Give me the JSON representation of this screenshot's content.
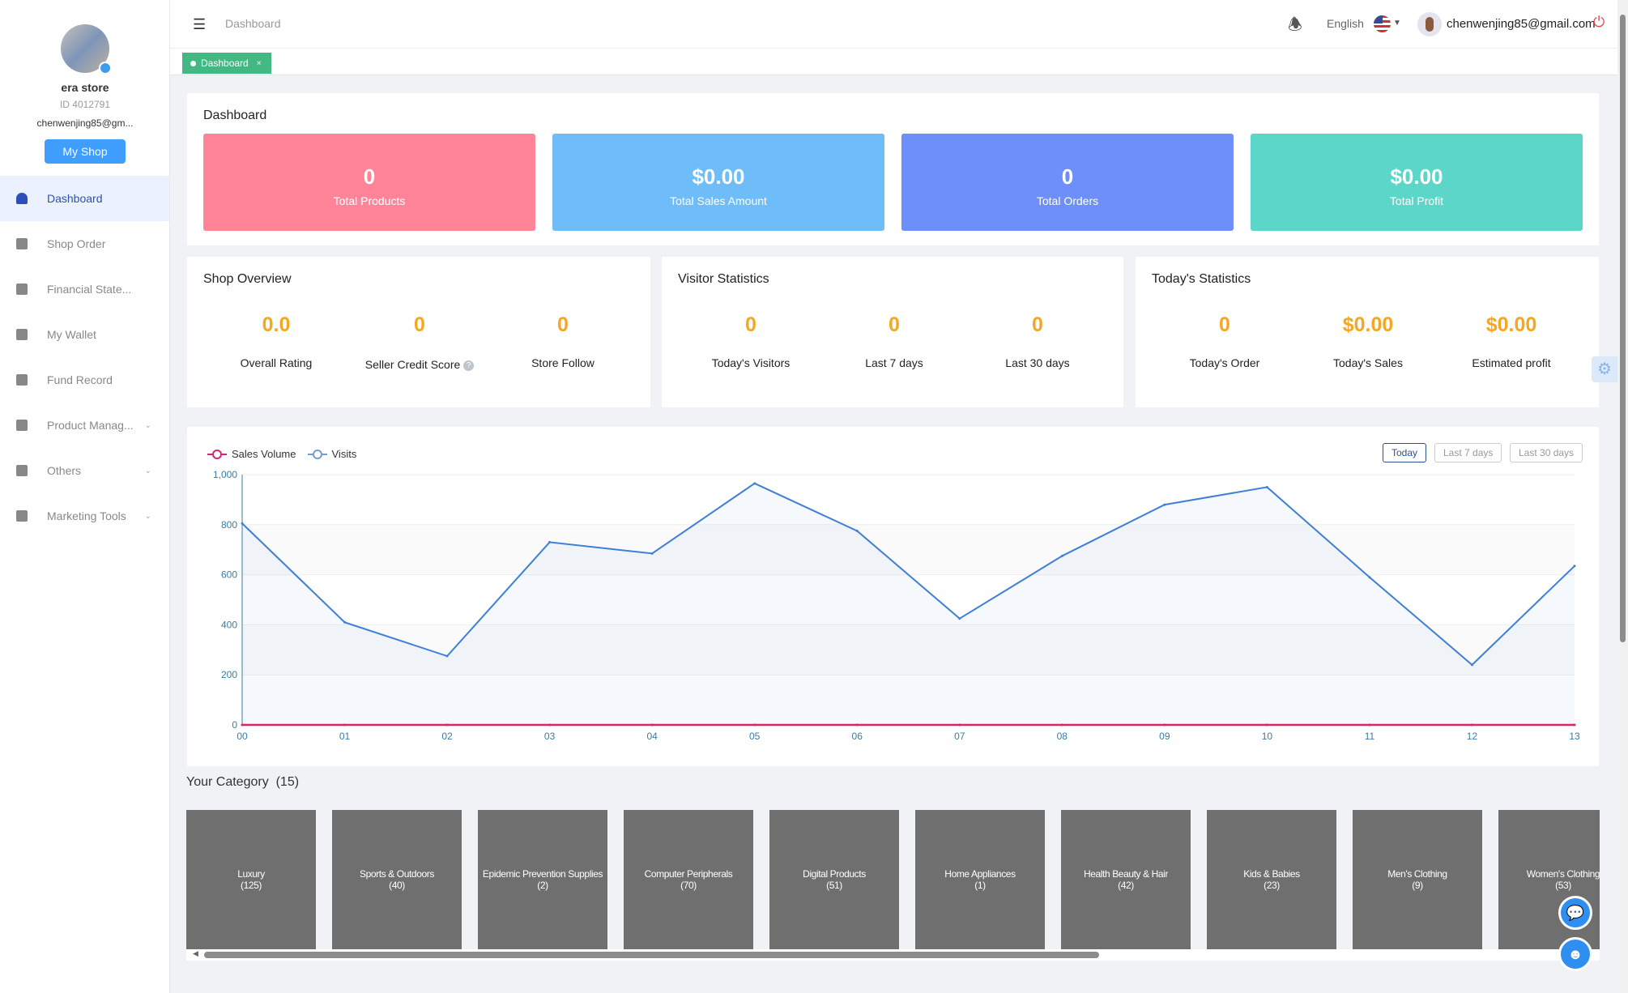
{
  "sidebar": {
    "store_name": "era store",
    "store_id": "ID 4012791",
    "email": "chenwenjing85@gm...",
    "my_shop": "My Shop",
    "items": [
      {
        "label": "Dashboard",
        "icon": "dashboard-icon"
      },
      {
        "label": "Shop Order",
        "icon": "clipboard-icon"
      },
      {
        "label": "Financial State...",
        "icon": "chart-icon"
      },
      {
        "label": "My Wallet",
        "icon": "wallet-icon"
      },
      {
        "label": "Fund Record",
        "icon": "file-icon"
      },
      {
        "label": "Product Manag...",
        "icon": "briefcase-icon"
      },
      {
        "label": "Others",
        "icon": "grid-icon"
      },
      {
        "label": "Marketing Tools",
        "icon": "bar-chart-icon"
      }
    ]
  },
  "header": {
    "breadcrumb": "Dashboard",
    "language": "English",
    "email": "chenwenjing85@gmail.com"
  },
  "tabs": [
    {
      "label": "Dashboard",
      "close": "×"
    }
  ],
  "dashboard": {
    "title": "Dashboard",
    "stats": [
      {
        "value": "0",
        "label": "Total Products",
        "color": "#ff8498"
      },
      {
        "value": "$0.00",
        "label": "Total Sales Amount",
        "color": "#6ebdf9"
      },
      {
        "value": "0",
        "label": "Total Orders",
        "color": "#6e8ffa"
      },
      {
        "value": "$0.00",
        "label": "Total Profit",
        "color": "#5cd6c9"
      }
    ]
  },
  "shop_overview": {
    "title": "Shop Overview",
    "items": [
      {
        "value": "0.0",
        "label": "Overall Rating"
      },
      {
        "value": "0",
        "label": "Seller Credit Score",
        "help": "?"
      },
      {
        "value": "0",
        "label": "Store Follow"
      }
    ]
  },
  "visitor_statistics": {
    "title": "Visitor Statistics",
    "items": [
      {
        "value": "0",
        "label": "Today's Visitors"
      },
      {
        "value": "0",
        "label": "Last 7 days"
      },
      {
        "value": "0",
        "label": "Last 30 days"
      }
    ]
  },
  "todays_statistics": {
    "title": "Today's Statistics",
    "items": [
      {
        "value": "0",
        "label": "Today's Order"
      },
      {
        "value": "$0.00",
        "label": "Today's Sales"
      },
      {
        "value": "$0.00",
        "label": "Estimated profit"
      }
    ]
  },
  "range_buttons": [
    "Today",
    "Last 7 days",
    "Last 30 days"
  ],
  "chart_data": {
    "type": "line",
    "categories": [
      "00",
      "01",
      "02",
      "03",
      "04",
      "05",
      "06",
      "07",
      "08",
      "09",
      "10",
      "11",
      "12",
      "13"
    ],
    "ylim": [
      0,
      1000
    ],
    "yticks": [
      0,
      200,
      400,
      600,
      800,
      1000
    ],
    "ytick_labels": [
      "0",
      "200",
      "400",
      "600",
      "800",
      "1,000"
    ],
    "legend_position": "top-left",
    "grid": true,
    "series": [
      {
        "name": "Sales Volume",
        "color": "#d6246e",
        "values": [
          0,
          0,
          0,
          0,
          0,
          0,
          0,
          0,
          0,
          0,
          0,
          0,
          0,
          0
        ]
      },
      {
        "name": "Visits",
        "color": "#3f7fd8",
        "values": [
          805,
          410,
          275,
          730,
          685,
          965,
          775,
          425,
          675,
          880,
          950,
          590,
          240,
          635
        ]
      }
    ]
  },
  "category": {
    "title": "Your Category",
    "count": "(15)",
    "items": [
      {
        "name": "Luxury",
        "count": "(125)"
      },
      {
        "name": "Sports & Outdoors",
        "count": "(40)"
      },
      {
        "name": "Epidemic Prevention Supplies",
        "count": "(2)"
      },
      {
        "name": "Computer Peripherals",
        "count": "(70)"
      },
      {
        "name": "Digital Products",
        "count": "(51)"
      },
      {
        "name": "Home Appliances",
        "count": "(1)"
      },
      {
        "name": "Health Beauty & Hair",
        "count": "(42)"
      },
      {
        "name": "Kids & Babies",
        "count": "(23)"
      },
      {
        "name": "Men's Clothing",
        "count": "(9)"
      },
      {
        "name": "Women's Clothing",
        "count": "(53)"
      }
    ]
  }
}
